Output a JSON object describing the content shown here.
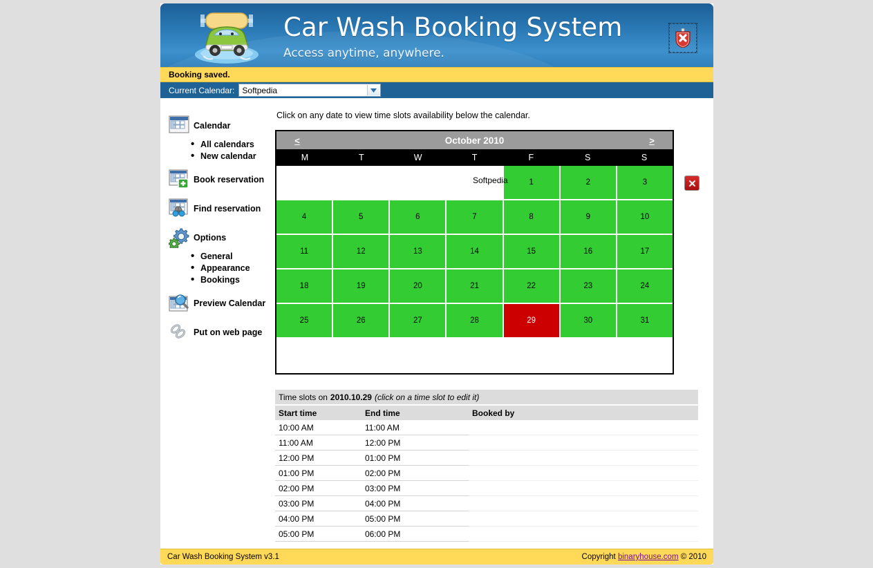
{
  "app": {
    "title": "Car Wash Booking System",
    "subtitle": "Access anytime, anywhere.",
    "close_label": "close",
    "logo_icon": "car-wash-logo-icon",
    "close_icon": "red-shield-x-icon"
  },
  "notice": {
    "message": "Booking saved."
  },
  "calendar_selector": {
    "label": "Current Calendar:",
    "value": "Softpedia",
    "chevron_icon": "chevron-down-icon",
    "accent": "#1f6296"
  },
  "sidebar": {
    "items": [
      {
        "label": "Calendar",
        "icon": "calendar-grid-icon",
        "children": [
          {
            "label": "All calendars"
          },
          {
            "label": "New calendar"
          }
        ]
      },
      {
        "label": "Book reservation",
        "icon": "calendar-add-icon",
        "children": []
      },
      {
        "label": "Find reservation",
        "icon": "calendar-binoculars-icon",
        "children": []
      },
      {
        "label": "Options",
        "icon": "gears-icon",
        "children": [
          {
            "label": "General"
          },
          {
            "label": "Appearance"
          },
          {
            "label": "Bookings"
          }
        ]
      },
      {
        "label": "Preview Calendar",
        "icon": "calendar-magnifier-icon",
        "children": []
      },
      {
        "label": "Put on web page",
        "icon": "chain-link-icon",
        "children": []
      }
    ]
  },
  "main": {
    "hint": "Click on any date to view time slots availability below the calendar."
  },
  "calendar": {
    "title": "October 2010",
    "prev_label": "<",
    "next_label": ">",
    "weekdays": [
      "M",
      "T",
      "W",
      "T",
      "F",
      "S",
      "S"
    ],
    "selected_day": 29,
    "colors": {
      "free": "#33cc33",
      "selected": "#cc0000",
      "header": "#9b9b9b",
      "dow": "#000000"
    },
    "weeks": [
      [
        null,
        null,
        null,
        null,
        1,
        2,
        3
      ],
      [
        4,
        5,
        6,
        7,
        8,
        9,
        10
      ],
      [
        11,
        12,
        13,
        14,
        15,
        16,
        17
      ],
      [
        18,
        19,
        20,
        21,
        22,
        23,
        24
      ],
      [
        25,
        26,
        27,
        28,
        29,
        30,
        31
      ],
      [
        null,
        null,
        null,
        null,
        null,
        null,
        null
      ]
    ]
  },
  "slots": {
    "caption_prefix": "Time slots on",
    "caption_date": "2010.10.29",
    "caption_suffix": "(click on a time slot to edit it)",
    "columns": [
      "Start time",
      "End time",
      "Booked by"
    ],
    "rows": [
      {
        "start": "10:00 AM",
        "end": "11:00 AM",
        "booked_by": ""
      },
      {
        "start": "11:00 AM",
        "end": "12:00 PM",
        "booked_by": ""
      },
      {
        "start": "12:00 PM",
        "end": "01:00 PM",
        "booked_by": ""
      },
      {
        "start": "01:00 PM",
        "end": "02:00 PM",
        "booked_by": ""
      },
      {
        "start": "02:00 PM",
        "end": "03:00 PM",
        "booked_by": ""
      },
      {
        "start": "03:00 PM",
        "end": "04:00 PM",
        "booked_by": ""
      },
      {
        "start": "04:00 PM",
        "end": "05:00 PM",
        "booked_by": ""
      },
      {
        "start": "05:00 PM",
        "end": "06:00 PM",
        "booked_by": ""
      }
    ],
    "booking": {
      "name": "Softpedia",
      "delete_icon": "delete-x-icon"
    }
  },
  "footer": {
    "version": "Car Wash Booking System v3.1",
    "copyright_prefix": "Copyright",
    "link": "binaryhouse.com",
    "copyright_suffix": "© 2010"
  }
}
